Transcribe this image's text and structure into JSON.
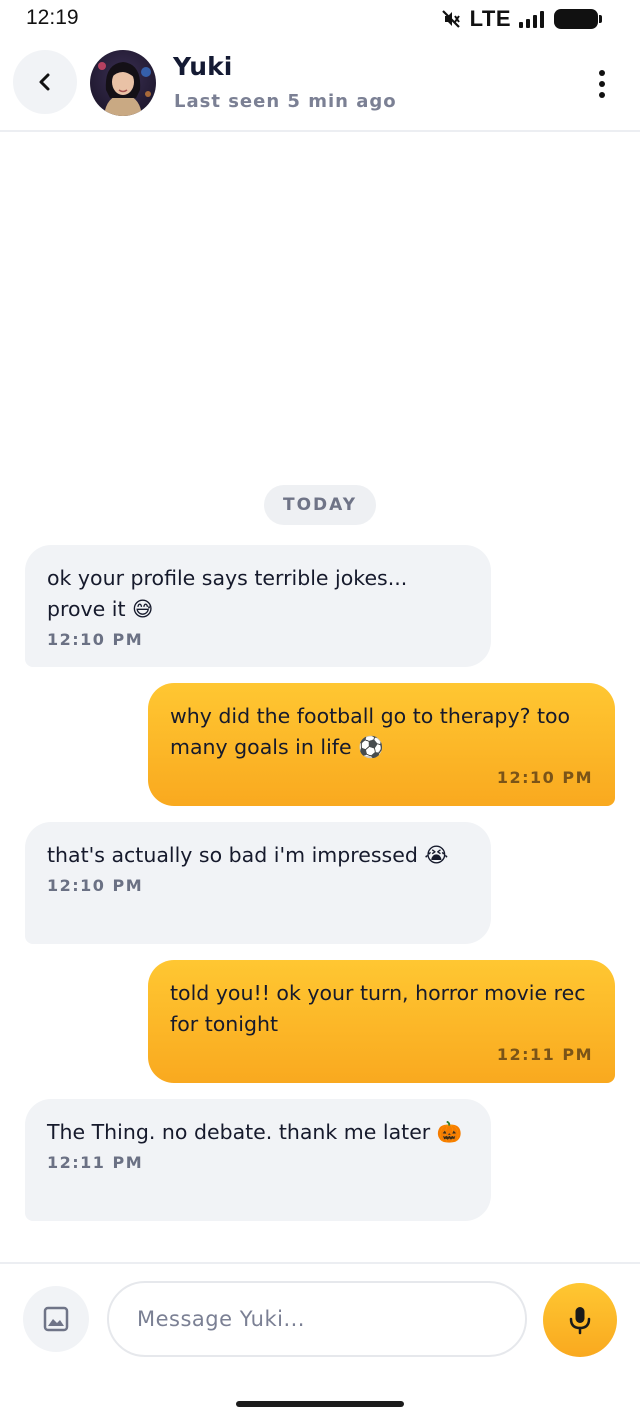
{
  "status_bar": {
    "time": "12:19",
    "network": "LTE",
    "icons": [
      "mute-icon",
      "signal-icon",
      "battery-icon"
    ]
  },
  "header": {
    "contact_name": "Yuki",
    "contact_status": "Last seen 5 min ago",
    "icons": [
      "back-arrow-icon",
      "more-vertical-icon"
    ]
  },
  "chat": {
    "date_label": "TODAY",
    "messages": [
      {
        "direction": "incoming",
        "text": "ok your profile says terrible jokes... prove it 😅",
        "time": "12:10 PM"
      },
      {
        "direction": "outgoing",
        "text": "why did the football go to therapy? too many goals in life ⚽",
        "time": "12:10 PM"
      },
      {
        "direction": "incoming",
        "text": "that's actually so bad i'm impressed 😭",
        "time": "12:10 PM"
      },
      {
        "direction": "outgoing",
        "text": "told you!! ok your turn, horror movie rec for tonight",
        "time": "12:11 PM"
      },
      {
        "direction": "incoming",
        "text": "The Thing. no debate. thank me later 🎃",
        "time": "12:11 PM"
      }
    ]
  },
  "composer": {
    "placeholder": "Message Yuki...",
    "value": "",
    "icons": [
      "image-icon",
      "microphone-icon"
    ]
  },
  "colors": {
    "accent": "#f9b424",
    "incoming_bubble": "#f1f3f6",
    "secondary_text": "#7b8094"
  }
}
